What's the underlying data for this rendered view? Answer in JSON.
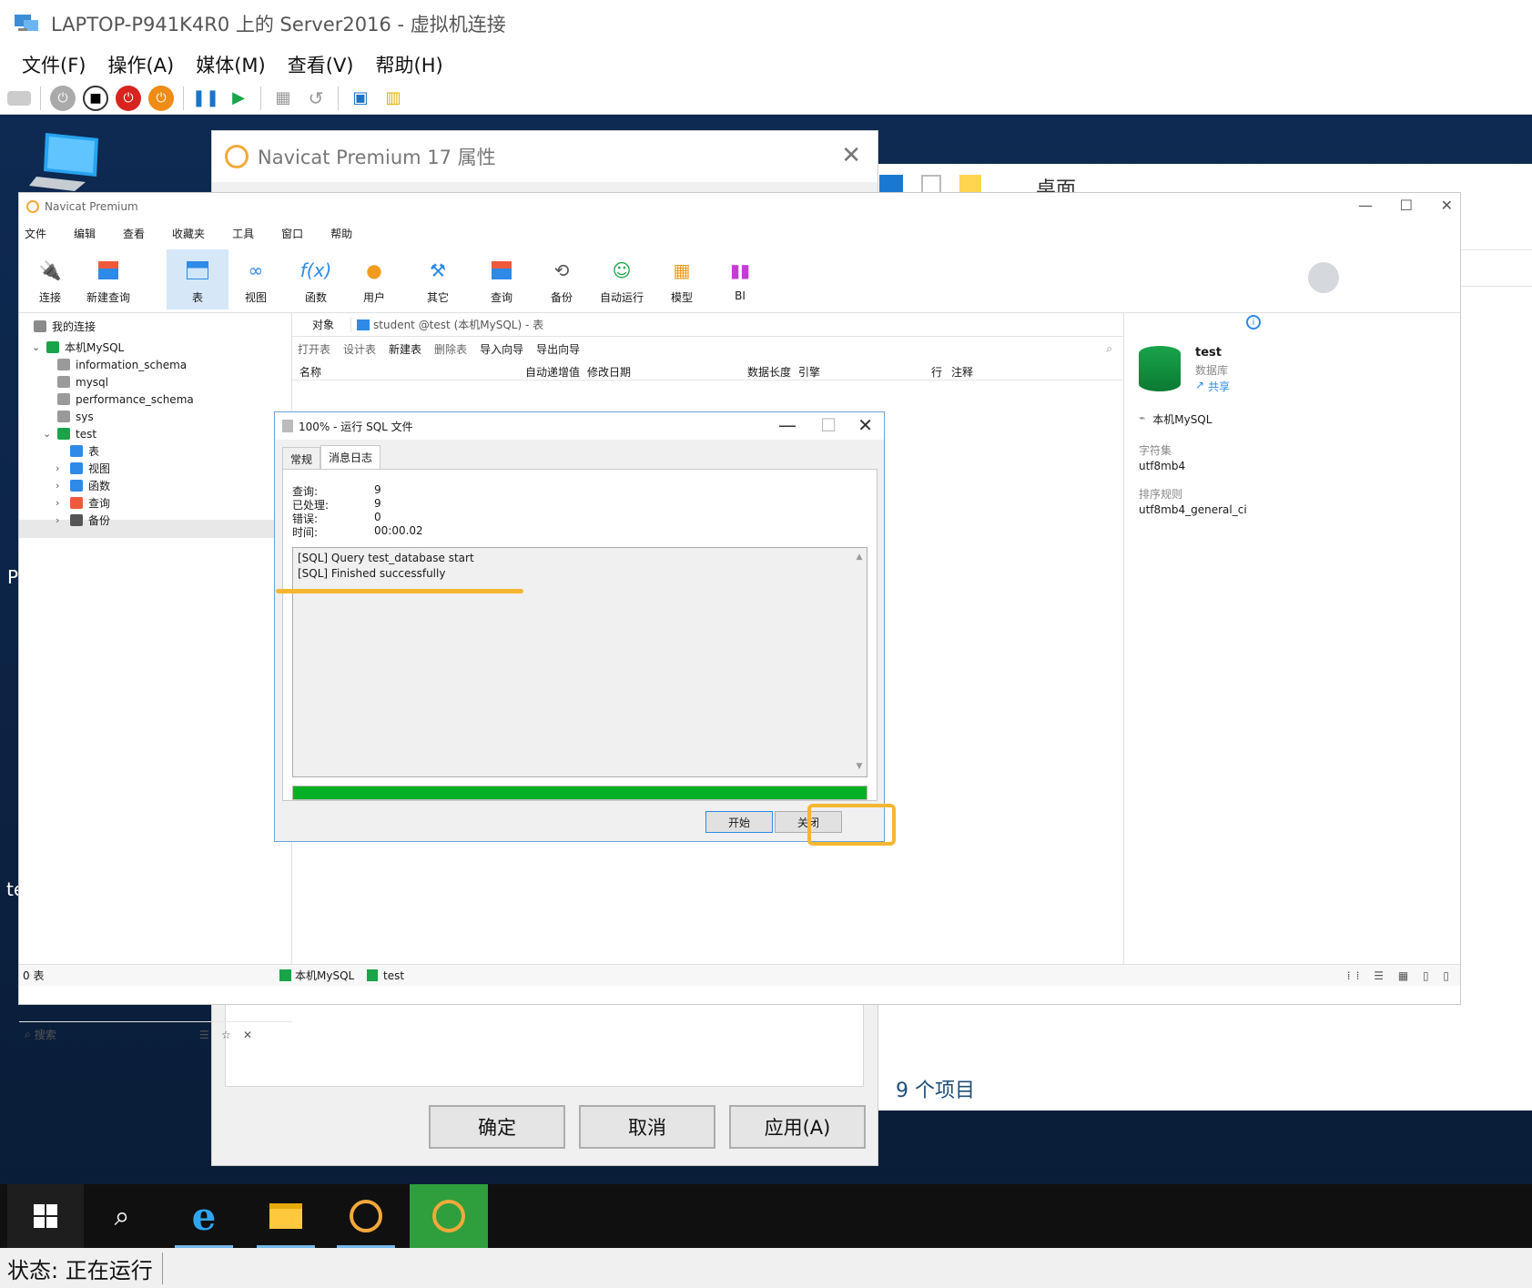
{
  "vm": {
    "title": "LAPTOP-P941K4R0 上的 Server2016 - 虚拟机连接",
    "menu": [
      "文件(F)",
      "操作(A)",
      "媒体(M)",
      "查看(V)",
      "帮助(H)"
    ],
    "status": "状态: 正在运行"
  },
  "desktop": {
    "left_label_p": "P",
    "left_label_te": "te"
  },
  "explorer": {
    "ribbon_label": "桌面",
    "item_count": "9 个项目"
  },
  "props_dialog": {
    "title": "Navicat Premium 17 属性",
    "ok": "确定",
    "cancel": "取消",
    "apply": "应用(A)"
  },
  "navicat": {
    "title": "Navicat Premium",
    "menu": [
      "文件",
      "编辑",
      "查看",
      "收藏夹",
      "工具",
      "窗口",
      "帮助"
    ],
    "toolbar": [
      "连接",
      "新建查询",
      "表",
      "视图",
      "函数",
      "用户",
      "其它",
      "查询",
      "备份",
      "自动运行",
      "模型",
      "BI"
    ],
    "tree": {
      "root": "我的连接",
      "connection": "本机MySQL",
      "databases": [
        "information_schema",
        "mysql",
        "performance_schema",
        "sys",
        "test"
      ],
      "test_children": [
        "表",
        "视图",
        "函数",
        "查询",
        "备份"
      ]
    },
    "search_placeholder": "搜索",
    "tabs": {
      "objects": "对象",
      "current": "student @test (本机MySQL) - 表"
    },
    "obj_toolbar": [
      "打开表",
      "设计表",
      "新建表",
      "删除表",
      "导入向导",
      "导出向导"
    ],
    "columns": [
      "名称",
      "自动递增值",
      "修改日期",
      "数据长度",
      "引擎",
      "行",
      "注释"
    ],
    "info": {
      "db_name": "test",
      "db_type": "数据库",
      "share": "共享",
      "connection": "本机MySQL",
      "charset_label": "字符集",
      "charset_value": "utf8mb4",
      "collation_label": "排序规则",
      "collation_value": "utf8mb4_general_ci"
    },
    "status": {
      "count": "0 表",
      "connection": "本机MySQL",
      "database": "test"
    }
  },
  "sql_dialog": {
    "title": "100% - 运行 SQL 文件",
    "tabs": [
      "常规",
      "消息日志"
    ],
    "stats": [
      {
        "label": "查询:",
        "value": "9"
      },
      {
        "label": "已处理:",
        "value": "9"
      },
      {
        "label": "错误:",
        "value": "0"
      },
      {
        "label": "时间:",
        "value": "00:00.02"
      }
    ],
    "log": [
      "[SQL] Query test_database start",
      "[SQL] Finished successfully"
    ],
    "progress": 1.0,
    "start": "开始",
    "close": "关闭"
  },
  "colors": {
    "accent": "#f5b731",
    "progress": "#06b025",
    "selection": "#d6e8f8"
  }
}
